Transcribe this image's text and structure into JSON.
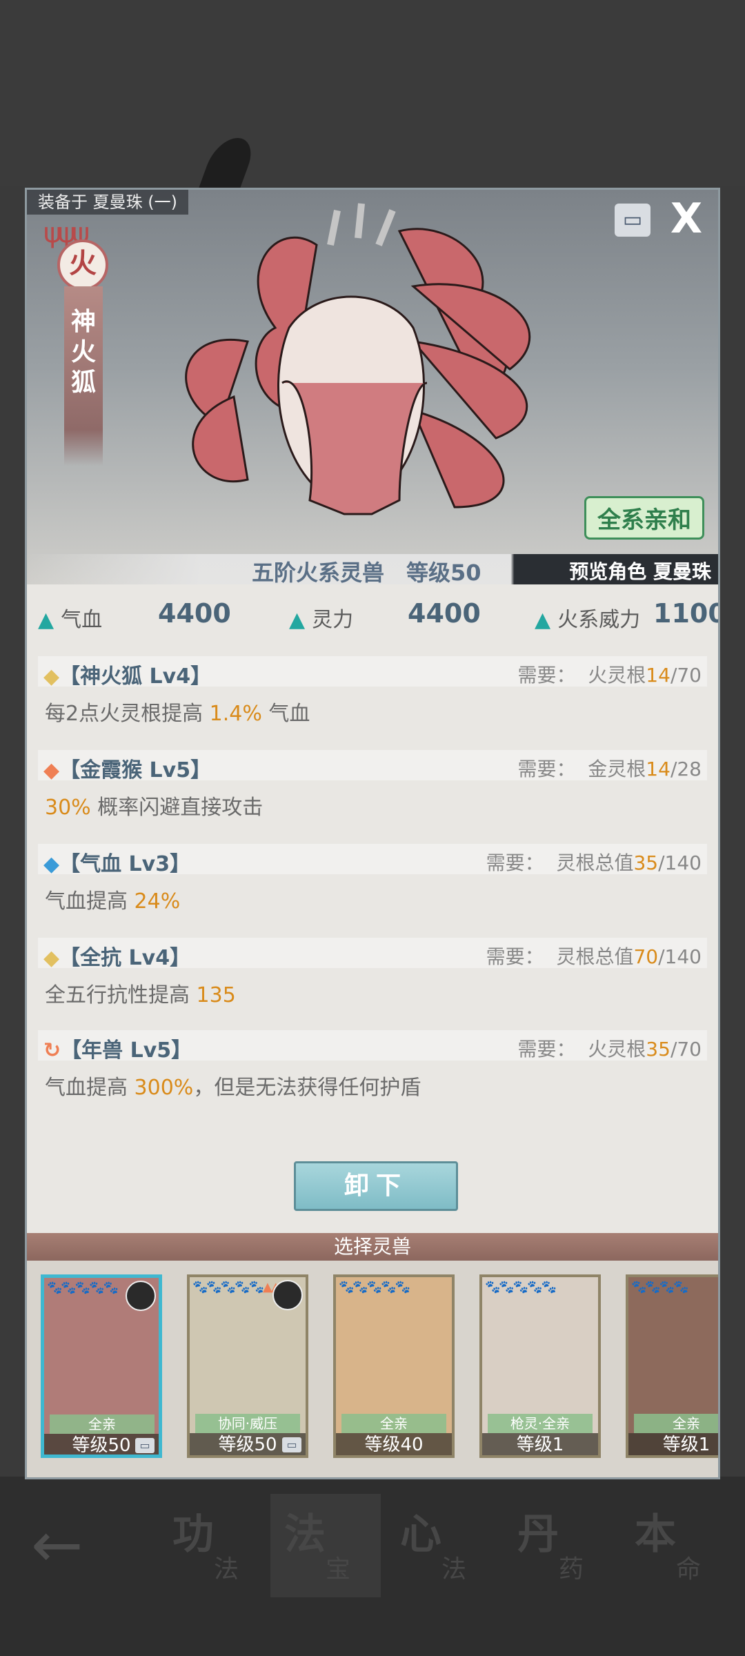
{
  "equip_label": "装备于 夏曼珠 (一)",
  "close_glyph": "X",
  "element": "火",
  "creature_name": "神火狐",
  "affinity_label": "全系亲和",
  "rank_level": "五阶火系灵兽　等级50",
  "preview_label": "预览角色 夏曼珠",
  "stats": [
    {
      "label": "气血",
      "value": "4400"
    },
    {
      "label": "灵力",
      "value": "4400"
    },
    {
      "label": "火系威力",
      "value": "1100"
    }
  ],
  "req_prefix": "需要：",
  "skills": [
    {
      "icon": "◆",
      "icon_color": "#e2c060",
      "name": "【神火狐 Lv4】",
      "req_type": "火灵根",
      "req_cur": "14",
      "req_max": "/70",
      "desc_pre": "每2点火灵根提高 ",
      "desc_hl": "1.4%",
      "desc_post": " 气血"
    },
    {
      "icon": "◆",
      "icon_color": "#ef7f54",
      "name": "【金霞猴 Lv5】",
      "req_type": "金灵根",
      "req_cur": "14",
      "req_max": "/28",
      "desc_pre": "",
      "desc_hl": "30%",
      "desc_post": " 概率闪避直接攻击"
    },
    {
      "icon": "◆",
      "icon_color": "#3a9bd8",
      "name": "【气血 Lv3】",
      "req_type": "灵根总值",
      "req_cur": "35",
      "req_max": "/140",
      "desc_pre": "气血提高 ",
      "desc_hl": "24%",
      "desc_post": ""
    },
    {
      "icon": "◆",
      "icon_color": "#e2c060",
      "name": "【全抗 Lv4】",
      "req_type": "灵根总值",
      "req_cur": "70",
      "req_max": "/140",
      "desc_pre": "全五行抗性提高 ",
      "desc_hl": "135",
      "desc_post": ""
    },
    {
      "icon": "↻",
      "icon_color": "#ef7f54",
      "name": "【年兽 Lv5】",
      "req_type": "火灵根",
      "req_cur": "35",
      "req_max": "/70",
      "desc_pre": "气血提高 ",
      "desc_hl": "300%",
      "desc_post": "，但是无法获得任何护盾"
    }
  ],
  "unequip_label": "卸下",
  "select_label": "选择灵兽",
  "cards": [
    {
      "tag": "全亲",
      "level": "等级50",
      "paws": "🐾🐾🐾🐾🐾",
      "art": "#b07c78"
    },
    {
      "tag": "协同·威压",
      "level": "等级50",
      "paws": "🐾🐾🐾🐾🐾▲▲",
      "art": "#cfc7b2"
    },
    {
      "tag": "全亲",
      "level": "等级40",
      "paws": "🐾🐾🐾🐾🐾",
      "art": "#d8b48a"
    },
    {
      "tag": "枪灵·全亲",
      "level": "等级1",
      "paws": "🐾🐾🐾🐾🐾",
      "art": "#d9cfc4"
    },
    {
      "tag": "全亲",
      "level": "等级1",
      "paws": "🐾🐾🐾🐾",
      "art": "#8d6a5c"
    }
  ],
  "nav": [
    {
      "big": "功",
      "small": "法"
    },
    {
      "big": "法",
      "small": "宝"
    },
    {
      "big": "心",
      "small": "法"
    },
    {
      "big": "丹",
      "small": "药"
    },
    {
      "big": "本",
      "small": "命"
    }
  ],
  "back_glyph": "←",
  "colors": {
    "accent": "#23a7a0",
    "highlight": "#d98b1b",
    "title_blue": "#4a6478",
    "selected_border": "#3fb8d0"
  }
}
